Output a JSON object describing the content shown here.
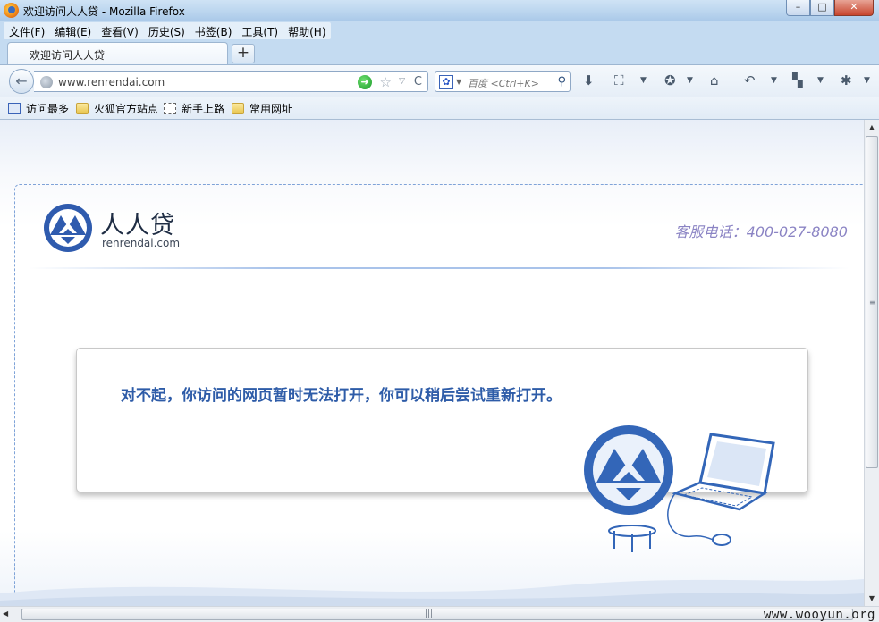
{
  "window": {
    "title": "欢迎访问人人贷 - Mozilla Firefox",
    "buttons": {
      "minimize": "–",
      "maximize": "□",
      "close": "✕"
    }
  },
  "menu": [
    "文件(F)",
    "编辑(E)",
    "查看(V)",
    "历史(S)",
    "书签(B)",
    "工具(T)",
    "帮助(H)"
  ],
  "tab": {
    "label": "欢迎访问人人贷",
    "new_tab": "+"
  },
  "nav": {
    "back": "←",
    "url": "www.renrendai.com",
    "go": "➜",
    "star": "☆",
    "dropdown": "▽",
    "reload": "C",
    "search_engine": "百度",
    "search_placeholder": "百度 <Ctrl+K>",
    "search_button": "⚲",
    "toolbar_icons": [
      "download-icon",
      "screenshot-icon",
      "addon-icon",
      "home-icon",
      "undo-icon",
      "apps-icon",
      "firebug-icon"
    ]
  },
  "bookmarks": [
    {
      "label": "访问最多",
      "icon": "most-visited-icon"
    },
    {
      "label": "火狐官方站点",
      "icon": "folder-icon"
    },
    {
      "label": "新手上路",
      "icon": "page-icon"
    },
    {
      "label": "常用网址",
      "icon": "folder-icon"
    }
  ],
  "page": {
    "brand": "人人贷",
    "domain": "renrendai.com",
    "hotline": "客服电话：400-027-8080",
    "message": "对不起，你访问的网页暂时无法打开，你可以稍后尝试重新打开。"
  },
  "scrollbar": {
    "up": "▲",
    "down": "▼",
    "left": "◀",
    "grip_v": "≡",
    "grip_h": "|||"
  },
  "watermark": "www.wooyun.org",
  "colors": {
    "brand_blue": "#2e5ca8",
    "hotline": "#8b84c4",
    "chrome": "#c4dbf1"
  }
}
